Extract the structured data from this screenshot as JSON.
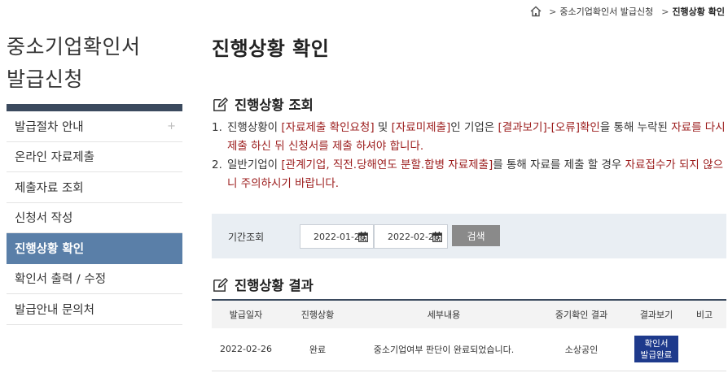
{
  "breadcrumb": {
    "home_icon": "home-icon",
    "items": [
      "중소기업확인서 발급신청",
      "진행상황 확인"
    ]
  },
  "sidebar": {
    "title_line1": "중소기업확인서",
    "title_line2": "발급신청",
    "items": [
      {
        "label": "발급절차 안내",
        "icon": "+"
      },
      {
        "label": "온라인 자료제출"
      },
      {
        "label": "제출자료 조회"
      },
      {
        "label": "신청서 작성"
      },
      {
        "label": "진행상황 확인",
        "active": true
      },
      {
        "label": "확인서 출력 / 수정"
      },
      {
        "label": "발급안내 문의처"
      }
    ],
    "active_color": "#5a7fa8",
    "bar_color": "#3b4a5e"
  },
  "main": {
    "page_title": "진행상황 확인",
    "query_section_title": "진행상황 조회",
    "notes": {
      "n1_num": "1.",
      "n1_p1": "진행상황이 ",
      "n1_r1": "[자료제출 확인요청]",
      "n1_p2": " 및 ",
      "n1_r2": "[자료미제출]",
      "n1_p3": "인 기업은 ",
      "n1_r3": "[결과보기]-[오류]확인",
      "n1_p4": "을 통해 누락된 ",
      "n1_r4": "자료를 다시 제출 하신 뒤 신청서를 제출 하셔야 합니다.",
      "n2_num": "2.",
      "n2_p1": "일반기업이 ",
      "n2_r1": "[관계기업, 직전.당해연도 분할.합병 자료제출]",
      "n2_p2": "를 통해 자료를 제출 할 경우 ",
      "n2_r2": "자료접수가 되지 않으니 주의하시기 바랍니다."
    },
    "search": {
      "label": "기간조회",
      "start_date": "2022-01-26",
      "end_date": "2022-02-26",
      "button_label": "검색"
    },
    "result_section_title": "진행상황 결과",
    "table": {
      "headers": [
        "발급일자",
        "진행상황",
        "세부내용",
        "중기확인 결과",
        "결과보기",
        "비고"
      ],
      "rows": [
        {
          "date": "2022-02-26",
          "status": "완료",
          "detail": "중소기업여부 판단이 완료되었습니다.",
          "result": "소상공인",
          "view_line1": "확인서",
          "view_line2": "발급완료",
          "note": ""
        }
      ]
    },
    "accent_red": "#9b1b1b",
    "button_blue": "#1e3a8c"
  }
}
